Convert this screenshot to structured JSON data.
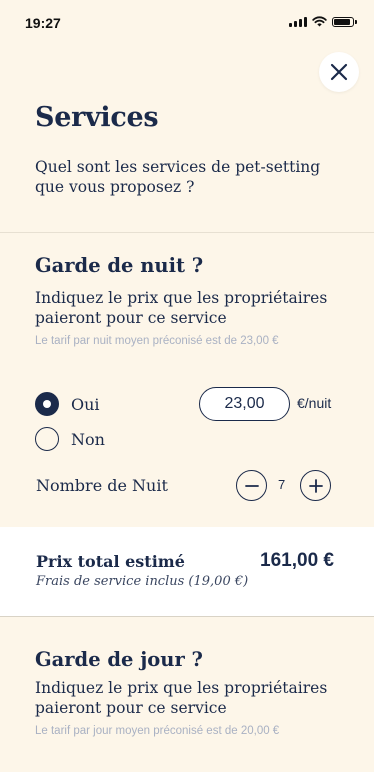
{
  "status_bar": {
    "time": "19:27"
  },
  "header": {
    "title": "Services",
    "intro": "Quel sont les services de pet-setting que vous proposez ?"
  },
  "night_care": {
    "title": "Garde de nuit ?",
    "description": "Indiquez le prix que les propriétaires paieront pour ce service",
    "hint": "Le tarif  par nuit moyen préconisé est de 23,00 €",
    "options": [
      {
        "label": "Oui",
        "selected": true
      },
      {
        "label": "Non",
        "selected": false
      }
    ],
    "price_value": "23,00",
    "price_unit": "€/nuit",
    "nights_label": "Nombre de Nuit",
    "nights_value": "7"
  },
  "total": {
    "label": "Prix total estimé",
    "sub": "Frais de service inclus (19,00 €)",
    "value": "161,00 €"
  },
  "day_care": {
    "title": "Garde de jour ?",
    "description": "Indiquez le prix que les propriétaires paieront pour ce service",
    "hint": "Le tarif  par jour moyen préconisé est de 20,00 €"
  },
  "icons": [
    "signal-icon",
    "wifi-icon",
    "battery-icon",
    "close-icon",
    "minus-icon",
    "plus-icon"
  ],
  "colors": {
    "background": "#fdf6e9",
    "primary": "#1b2a4a",
    "hint": "#a9b1c3",
    "panel": "#ffffff"
  }
}
